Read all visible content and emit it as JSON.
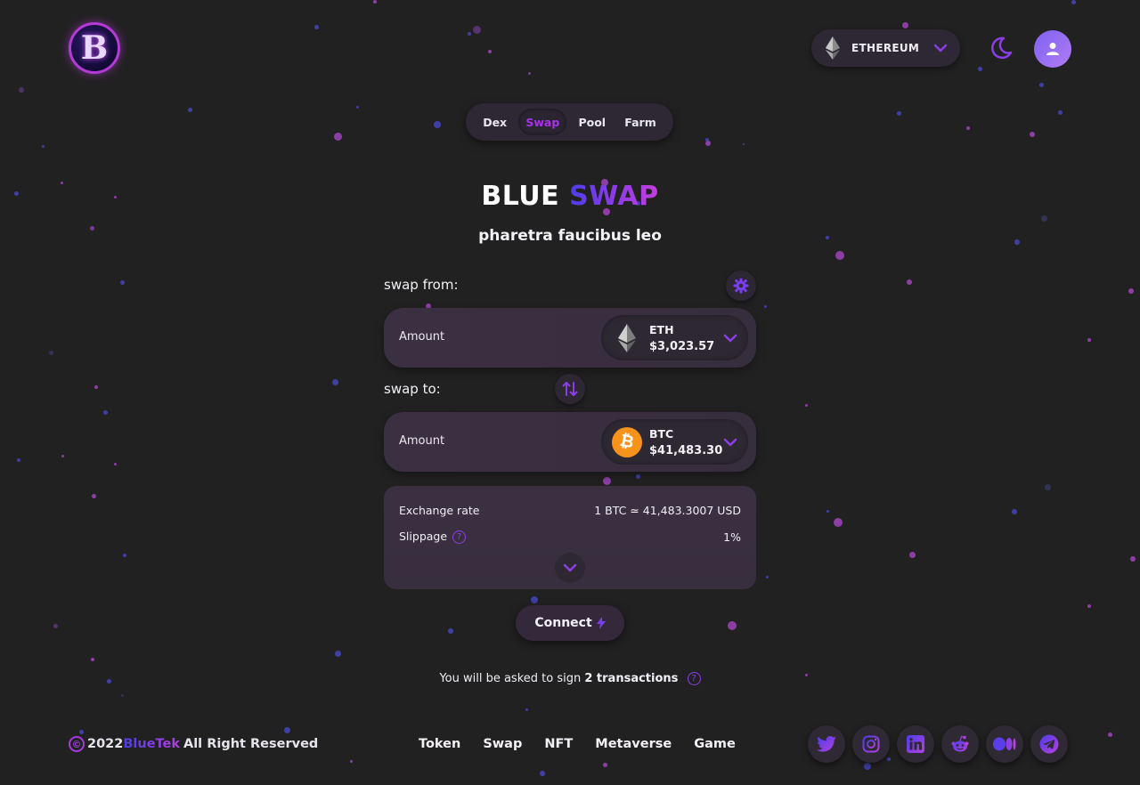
{
  "header": {
    "logo_letter": "B",
    "network": {
      "label": "ETHEREUM",
      "icon": "ethereum-icon"
    },
    "theme_icon": "moon-icon",
    "user_icon": "user-icon"
  },
  "tabs": [
    {
      "label": "Dex",
      "active": false
    },
    {
      "label": "Swap",
      "active": true
    },
    {
      "label": "Pool",
      "active": false
    },
    {
      "label": "Farm",
      "active": false
    }
  ],
  "hero": {
    "title_part1": "BLUE",
    "title_part2": "SWAP",
    "subtitle": "pharetra faucibus leo"
  },
  "swap_from": {
    "label": "swap from:",
    "amount_label": "Amount",
    "token": {
      "symbol": "ETH",
      "price": "$3,023.57",
      "icon": "ethereum-icon"
    }
  },
  "swap_to": {
    "label": "swap to:",
    "amount_label": "Amount",
    "token": {
      "symbol": "BTC",
      "price": "$41,483.30",
      "icon": "bitcoin-icon"
    }
  },
  "info": {
    "exchange_rate_label": "Exchange rate",
    "exchange_rate_value": "1 BTC ≃ 41,483.3007 USD",
    "slippage_label": "Slippage",
    "slippage_value": "1%"
  },
  "connect_label": "Connect",
  "note": {
    "prefix": "You will be asked to sign",
    "count": "2 transactions"
  },
  "footer": {
    "copyright_symbol": "©",
    "year": "2022",
    "brand": "BlueTek",
    "rights": "All Right Reserved",
    "nav": [
      "Token",
      "Swap",
      "NFT",
      "Metaverse",
      "Game"
    ],
    "socials": [
      "twitter-icon",
      "instagram-icon",
      "linkedin-icon",
      "reddit-icon",
      "medium-icon",
      "telegram-icon"
    ]
  },
  "colors": {
    "background": "#222122",
    "accent_purple": "#8c3ee6",
    "accent_blue": "#4b3ee8",
    "bitcoin_orange": "#f7931a"
  }
}
